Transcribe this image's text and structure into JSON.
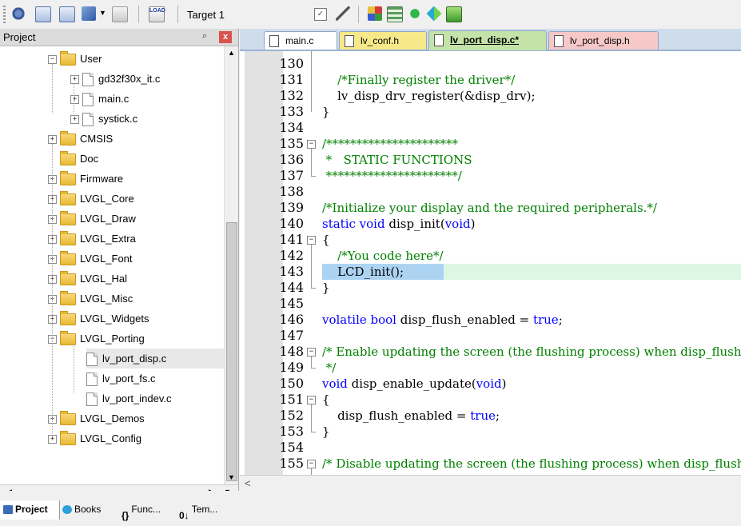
{
  "toolbar": {
    "target_label": "Target 1",
    "build_icons": [
      "batch-setup-icon",
      "translate-icon",
      "build-icon",
      "rebuild-icon",
      "batch-build-icon",
      "download-icon"
    ],
    "tool_icons": [
      "options-wand-icon",
      "manage-components-icon",
      "project-items-icon",
      "pack-installer-icon",
      "select-software-packs-icon",
      "run-time-env-icon"
    ]
  },
  "project_pane": {
    "title": "Project",
    "pin_symbol": "⌕",
    "close_symbol": "x",
    "tree": [
      {
        "label": "User",
        "type": "folder",
        "expanded": true,
        "level": 0
      },
      {
        "label": "gd32f30x_it.c",
        "type": "file",
        "expandable": true,
        "level": 1
      },
      {
        "label": "main.c",
        "type": "file",
        "expandable": true,
        "level": 1
      },
      {
        "label": "systick.c",
        "type": "file",
        "expandable": true,
        "level": 1
      },
      {
        "label": "CMSIS",
        "type": "folder",
        "expanded": false,
        "level": 0
      },
      {
        "label": "Doc",
        "type": "folder",
        "expanded": null,
        "level": 0
      },
      {
        "label": "Firmware",
        "type": "folder",
        "expanded": false,
        "level": 0
      },
      {
        "label": "LVGL_Core",
        "type": "folder",
        "expanded": false,
        "level": 0
      },
      {
        "label": "LVGL_Draw",
        "type": "folder",
        "expanded": false,
        "level": 0
      },
      {
        "label": "LVGL_Extra",
        "type": "folder",
        "expanded": false,
        "level": 0
      },
      {
        "label": "LVGL_Font",
        "type": "folder",
        "expanded": false,
        "level": 0
      },
      {
        "label": "LVGL_Hal",
        "type": "folder",
        "expanded": false,
        "level": 0
      },
      {
        "label": "LVGL_Misc",
        "type": "folder",
        "expanded": false,
        "level": 0
      },
      {
        "label": "LVGL_Widgets",
        "type": "folder",
        "expanded": false,
        "level": 0
      },
      {
        "label": "LVGL_Porting",
        "type": "folder",
        "expanded": true,
        "level": 0
      },
      {
        "label": "lv_port_disp.c",
        "type": "file",
        "expandable": false,
        "level": 1,
        "selected": true
      },
      {
        "label": "lv_port_fs.c",
        "type": "file",
        "expandable": false,
        "level": 1
      },
      {
        "label": "lv_port_indev.c",
        "type": "file",
        "expandable": false,
        "level": 1
      },
      {
        "label": "LVGL_Demos",
        "type": "folder",
        "expanded": false,
        "level": 0
      },
      {
        "label": "LVGL_Config",
        "type": "folder",
        "expanded": false,
        "level": 0
      }
    ],
    "bottom_tabs": [
      {
        "label": "Project",
        "icon": "project-icon",
        "active": true
      },
      {
        "label": "Books",
        "icon": "books-icon",
        "active": false
      },
      {
        "label": "Func...",
        "icon": "functions-icon",
        "prefix": "{}",
        "active": false
      },
      {
        "label": "Tem...",
        "icon": "templates-icon",
        "prefix": "0↓",
        "active": false
      }
    ]
  },
  "editor": {
    "tabs": [
      {
        "label": "main.c",
        "color": "#ffffff",
        "active": false
      },
      {
        "label": "lv_conf.h",
        "color": "#f7e98a",
        "active": false
      },
      {
        "label": "lv_port_disp.c*",
        "color": "#c4e3a8",
        "active": true
      },
      {
        "label": "lv_port_disp.h",
        "color": "#f6c8c8",
        "active": false
      }
    ],
    "lines": [
      {
        "n": "130",
        "parts": []
      },
      {
        "n": "131",
        "parts": [
          {
            "t": "    "
          },
          {
            "t": "/*Finally register the driver*/",
            "c": "cm"
          }
        ]
      },
      {
        "n": "132",
        "parts": [
          {
            "t": "    lv_disp_drv_register(&disp_drv);"
          }
        ]
      },
      {
        "n": "133",
        "parts": [
          {
            "t": "}"
          }
        ]
      },
      {
        "n": "134",
        "parts": []
      },
      {
        "n": "135",
        "parts": [
          {
            "t": "/**********************",
            "c": "cm"
          }
        ],
        "fold": "minus"
      },
      {
        "n": "136",
        "parts": [
          {
            "t": " *   STATIC FUNCTIONS",
            "c": "cm"
          }
        ]
      },
      {
        "n": "137",
        "parts": [
          {
            "t": " **********************/",
            "c": "cm"
          }
        ]
      },
      {
        "n": "138",
        "parts": []
      },
      {
        "n": "139",
        "parts": [
          {
            "t": "/*Initialize your display and the required peripherals.*/",
            "c": "cm"
          }
        ]
      },
      {
        "n": "140",
        "parts": [
          {
            "t": "static void",
            "c": "kw"
          },
          {
            "t": " disp_init("
          },
          {
            "t": "void",
            "c": "kw"
          },
          {
            "t": ")"
          }
        ]
      },
      {
        "n": "141",
        "parts": [
          {
            "t": "{"
          }
        ],
        "fold": "minus"
      },
      {
        "n": "142",
        "parts": [
          {
            "t": "    "
          },
          {
            "t": "/*You code here*/",
            "c": "cm"
          }
        ]
      },
      {
        "n": "143",
        "parts": [
          {
            "t": "    LCD_init();"
          }
        ],
        "highlight": true
      },
      {
        "n": "144",
        "parts": [
          {
            "t": "}"
          }
        ]
      },
      {
        "n": "145",
        "parts": []
      },
      {
        "n": "146",
        "parts": [
          {
            "t": "volatile bool",
            "c": "kw"
          },
          {
            "t": " disp_flush_enabled = "
          },
          {
            "t": "true",
            "c": "kw"
          },
          {
            "t": ";"
          }
        ]
      },
      {
        "n": "147",
        "parts": []
      },
      {
        "n": "148",
        "parts": [
          {
            "t": "/* Enable updating the screen (the flushing process) when disp_flush() is called by LVGL",
            "c": "cm"
          }
        ],
        "fold": "minus"
      },
      {
        "n": "149",
        "parts": [
          {
            "t": " */",
            "c": "cm"
          }
        ]
      },
      {
        "n": "150",
        "parts": [
          {
            "t": "void",
            "c": "kw"
          },
          {
            "t": " disp_enable_update("
          },
          {
            "t": "void",
            "c": "kw"
          },
          {
            "t": ")"
          }
        ]
      },
      {
        "n": "151",
        "parts": [
          {
            "t": "{"
          }
        ],
        "fold": "minus"
      },
      {
        "n": "152",
        "parts": [
          {
            "t": "    disp_flush_enabled = "
          },
          {
            "t": "true",
            "c": "kw"
          },
          {
            "t": ";"
          }
        ]
      },
      {
        "n": "153",
        "parts": [
          {
            "t": "}"
          }
        ]
      },
      {
        "n": "154",
        "parts": []
      },
      {
        "n": "155",
        "parts": [
          {
            "t": "/* Disable updating the screen (the flushing process) when disp_flush() is called by LVGL",
            "c": "cm"
          }
        ],
        "fold": "minus"
      }
    ]
  },
  "colors": {
    "comment": "#008000",
    "keyword": "#0000ff",
    "current_line": "#dcf7e4",
    "selection": "#add3f2",
    "tab_bar": "#cfdcec"
  }
}
